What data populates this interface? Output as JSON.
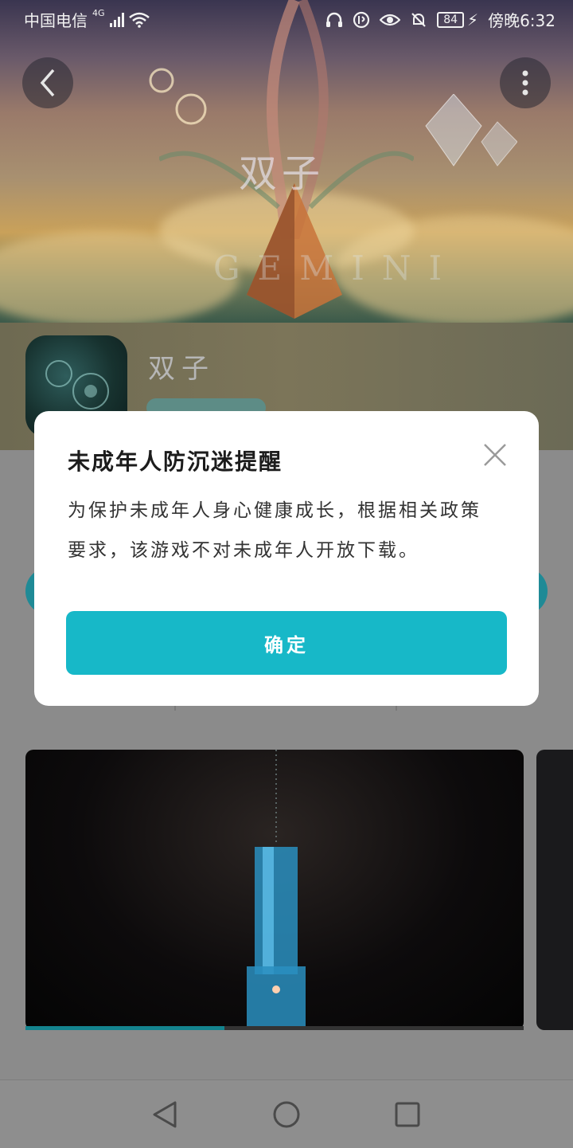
{
  "status_bar": {
    "carrier": "中国电信",
    "network": "4G",
    "time": "傍晚6:32",
    "battery": "84"
  },
  "hero": {
    "title_art": "双子",
    "subtitle_art": "GEMINI"
  },
  "app": {
    "name": "双子"
  },
  "dialog": {
    "title": "未成年人防沉迷提醒",
    "body": "为保护未成年人身心健康成长，根据相关政策要求，该游戏不对未成年人开放下载。",
    "confirm_label": "确定"
  },
  "screenshots": {
    "progress": 0.4
  },
  "colors": {
    "accent": "#17b8c8",
    "dialog_bg": "#ffffff",
    "overlay": "#8e8e8e"
  }
}
